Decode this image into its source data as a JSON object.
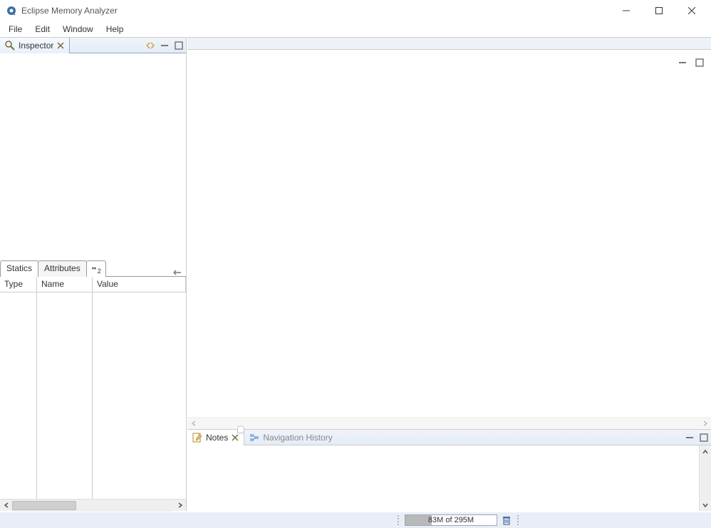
{
  "window": {
    "title": "Eclipse Memory Analyzer"
  },
  "menu": {
    "items": [
      "File",
      "Edit",
      "Window",
      "Help"
    ]
  },
  "inspector": {
    "tab_label": "Inspector",
    "tabs": {
      "statics": "Statics",
      "attributes": "Attributes",
      "overflow_count": "2"
    },
    "columns": {
      "type": "Type",
      "name": "Name",
      "value": "Value"
    }
  },
  "bottom": {
    "notes_label": "Notes",
    "nav_history_label": "Navigation History"
  },
  "status": {
    "heap_text": "83M of 295M"
  }
}
